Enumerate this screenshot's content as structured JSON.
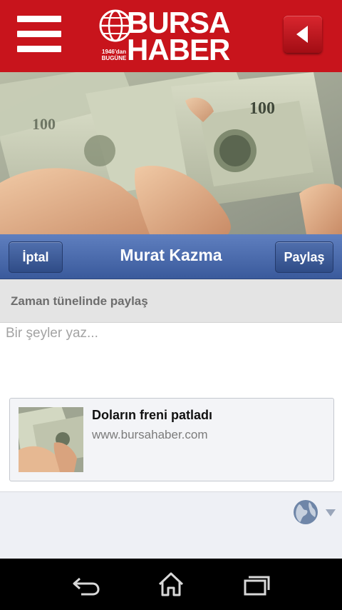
{
  "app_bar": {
    "logo": {
      "line1": "BURSA",
      "line2": "HABER",
      "since_line1": "1946'dan",
      "since_line2": "BUGÜNE"
    },
    "menu_icon": "hamburger-menu-icon",
    "back_icon": "back-arrow-icon",
    "accent_color": "#c8141c"
  },
  "share_sheet": {
    "cancel_label": "İptal",
    "title": "Murat Kazma",
    "share_label": "Paylaş",
    "header_color": "#3f5f9f",
    "target_label": "Zaman tünelinde paylaş",
    "compose_placeholder": "Bir şeyler yaz...",
    "link_preview": {
      "title": "Doların freni patladı",
      "url": "www.bursahaber.com"
    },
    "audience_icon": "globe-icon"
  },
  "system_nav": {
    "back_icon": "back-icon",
    "home_icon": "home-icon",
    "recents_icon": "recent-apps-icon"
  }
}
